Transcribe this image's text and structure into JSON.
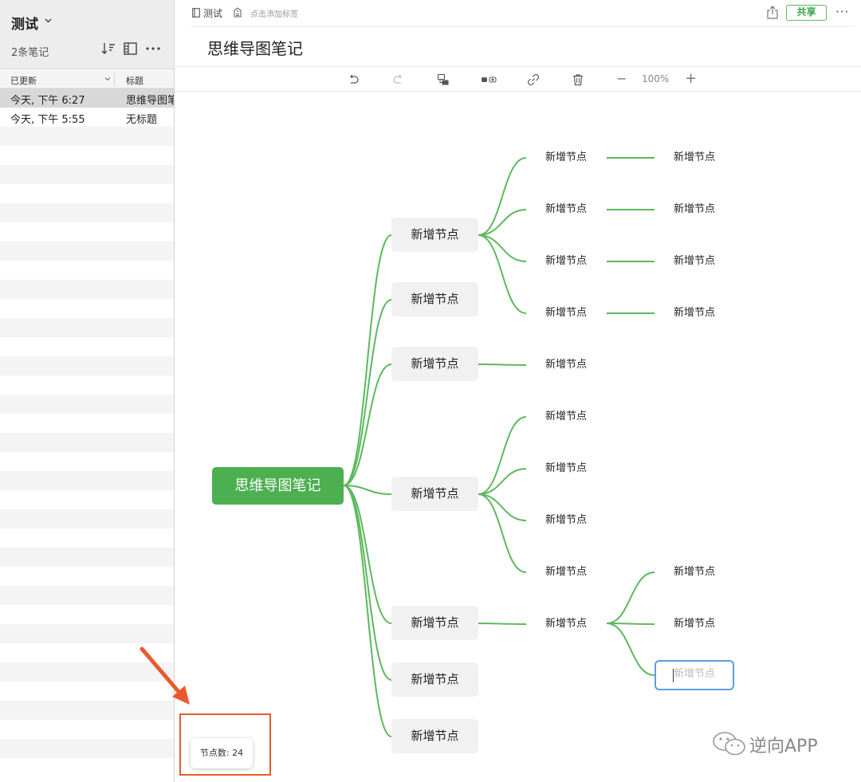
{
  "sidebar": {
    "notebook_title": "测试",
    "note_count": "2条笔记",
    "column_updated": "已更新",
    "column_title": "标题",
    "notes": [
      {
        "updated": "今天, 下午 6:27",
        "title": "思维导图笔记",
        "selected": true
      },
      {
        "updated": "今天, 下午 5:55",
        "title": "无标题",
        "selected": false
      }
    ]
  },
  "topbar": {
    "notebook": "测试",
    "tag_placeholder": "点击添加标签",
    "share_label": "共享",
    "more_label": "···"
  },
  "document": {
    "title": "思维导图笔记"
  },
  "toolbar": {
    "zoom": "100%",
    "zoom_out": "−",
    "zoom_in": "+"
  },
  "mindmap": {
    "root": "思维导图笔记",
    "node_label": "新增节点",
    "editing_placeholder": "新增节点",
    "node_count_label": "节点数: 24",
    "line_color": "#5cb85c",
    "root_color": "#4caf50"
  },
  "annotation": {
    "highlight_color": "#e85a2d"
  },
  "watermark": {
    "text": "逆向APP"
  }
}
